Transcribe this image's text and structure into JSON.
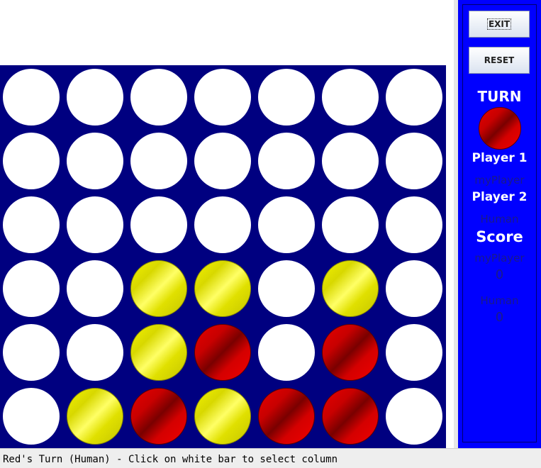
{
  "buttons": {
    "exit_label": "EXIT",
    "reset_label": "RESET"
  },
  "side_panel": {
    "turn_title": "TURN",
    "turn_color": "red",
    "player1_label": "Player 1",
    "player1_name": "myPlayer",
    "player2_label": "Player 2",
    "player2_name": "Human",
    "score_title": "Score",
    "scores": [
      {
        "name": "myPlayer",
        "value": "0"
      },
      {
        "name": "Human",
        "value": "0"
      }
    ]
  },
  "board": {
    "rows": 6,
    "columns": 7,
    "cells": [
      [
        "empty",
        "empty",
        "empty",
        "empty",
        "empty",
        "empty",
        "empty"
      ],
      [
        "empty",
        "empty",
        "empty",
        "empty",
        "empty",
        "empty",
        "empty"
      ],
      [
        "empty",
        "empty",
        "empty",
        "empty",
        "empty",
        "empty",
        "empty"
      ],
      [
        "empty",
        "empty",
        "yellow",
        "yellow",
        "empty",
        "yellow",
        "empty"
      ],
      [
        "empty",
        "empty",
        "yellow",
        "red",
        "empty",
        "red",
        "empty"
      ],
      [
        "empty",
        "yellow",
        "red",
        "yellow",
        "red",
        "red",
        "empty"
      ]
    ]
  },
  "colors": {
    "board": "#000080",
    "panel": "#0000ff",
    "red_disc": "#cc0000",
    "yellow_disc": "#e8e800",
    "empty_slot": "#ffffff"
  },
  "status": {
    "text": "Red's Turn (Human) - Click on white bar to select column"
  }
}
